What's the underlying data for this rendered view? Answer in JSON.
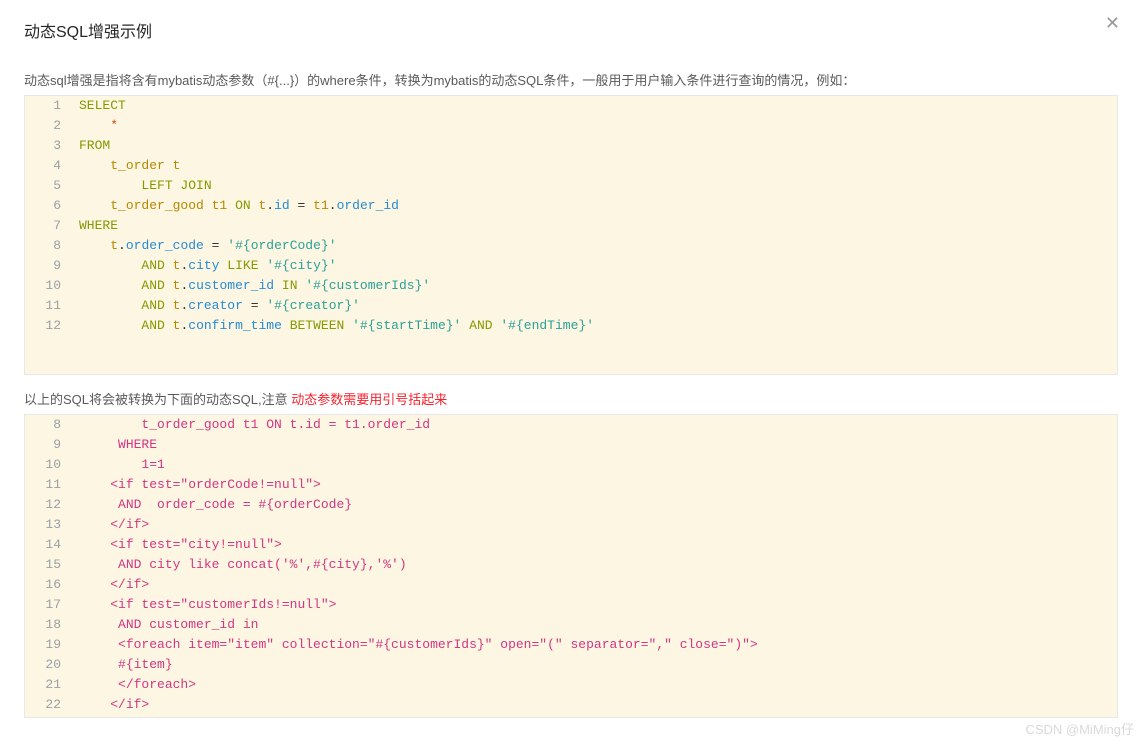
{
  "modal": {
    "title": "动态SQL增强示例",
    "close": "✕"
  },
  "section1": {
    "desc": "动态sql增强是指将含有mybatis动态参数（#{...}）的where条件，转换为mybatis的动态SQL条件，一般用于用户输入条件进行查询的情况，例如：",
    "lines": [
      {
        "n": "1",
        "html": "<span class='tok-kw'>SELECT</span>"
      },
      {
        "n": "2",
        "html": "    <span class='tok-star'>*</span>"
      },
      {
        "n": "3",
        "html": "<span class='tok-kw'>FROM</span>"
      },
      {
        "n": "4",
        "html": "    <span class='tok-id'>t_order t</span>"
      },
      {
        "n": "5",
        "html": "        <span class='tok-kw'>LEFT JOIN</span>"
      },
      {
        "n": "6",
        "html": "    <span class='tok-id'>t_order_good t1</span> <span class='tok-kw'>ON</span> <span class='tok-id'>t</span>.<span class='tok-col'>id</span> <span class='tok-op'>=</span> <span class='tok-id'>t1</span>.<span class='tok-col'>order_id</span>"
      },
      {
        "n": "7",
        "html": "<span class='tok-kw'>WHERE</span>"
      },
      {
        "n": "8",
        "html": "    <span class='tok-id'>t</span>.<span class='tok-col'>order_code</span> <span class='tok-op'>=</span> <span class='tok-str'>'#{orderCode}'</span>"
      },
      {
        "n": "9",
        "html": "        <span class='tok-kw'>AND</span> <span class='tok-id'>t</span>.<span class='tok-col'>city</span> <span class='tok-kw'>LIKE</span> <span class='tok-str'>'#{city}'</span>"
      },
      {
        "n": "10",
        "html": "        <span class='tok-kw'>AND</span> <span class='tok-id'>t</span>.<span class='tok-col'>customer_id</span> <span class='tok-kw'>IN</span> <span class='tok-str'>'#{customerIds}'</span>"
      },
      {
        "n": "11",
        "html": "        <span class='tok-kw'>AND</span> <span class='tok-id'>t</span>.<span class='tok-col'>creator</span> <span class='tok-op'>=</span> <span class='tok-str'>'#{creator}'</span>"
      },
      {
        "n": "12",
        "html": "        <span class='tok-kw'>AND</span> <span class='tok-id'>t</span>.<span class='tok-col'>confirm_time</span> <span class='tok-kw'>BETWEEN</span> <span class='tok-str'>'#{startTime}'</span> <span class='tok-kw'>AND</span> <span class='tok-str'>'#{endTime}'</span>"
      }
    ]
  },
  "section2": {
    "desc_pre": "以上的SQL将会被转换为下面的动态SQL,注意 ",
    "desc_warn": "动态参数需要用引号括起来",
    "lines": [
      {
        "n": "8",
        "html": "        <span class='tok-pink'>t_order_good t1 ON t.id = t1.order_id</span>"
      },
      {
        "n": "9",
        "html": "     <span class='tok-pink'>WHERE</span>"
      },
      {
        "n": "10",
        "html": "        <span class='tok-pink'>1=1</span>"
      },
      {
        "n": "11",
        "html": "    <span class='tok-pink'>&lt;if test=\"orderCode!=null\"&gt;</span>"
      },
      {
        "n": "12",
        "html": "     <span class='tok-pink'>AND  order_code = #{orderCode}</span>"
      },
      {
        "n": "13",
        "html": "    <span class='tok-pink'>&lt;/if&gt;</span>"
      },
      {
        "n": "14",
        "html": "    <span class='tok-pink'>&lt;if test=\"city!=null\"&gt;</span>"
      },
      {
        "n": "15",
        "html": "     <span class='tok-pink'>AND city like concat('%',#{city},'%')</span>"
      },
      {
        "n": "16",
        "html": "    <span class='tok-pink'>&lt;/if&gt;</span>"
      },
      {
        "n": "17",
        "html": "    <span class='tok-pink'>&lt;if test=\"customerIds!=null\"&gt;</span>"
      },
      {
        "n": "18",
        "html": "     <span class='tok-pink'>AND customer_id in</span>"
      },
      {
        "n": "19",
        "html": "     <span class='tok-pink'>&lt;foreach item=\"item\" collection=\"#{customerIds}\" open=\"(\" separator=\",\" close=\")\"&gt;</span>"
      },
      {
        "n": "20",
        "html": "     <span class='tok-pink'>#{item}</span>"
      },
      {
        "n": "21",
        "html": "     <span class='tok-pink'>&lt;/foreach&gt;</span>"
      },
      {
        "n": "22",
        "html": "    <span class='tok-pink'>&lt;/if&gt;</span>"
      }
    ]
  },
  "watermark": "CSDN @MiMing仔"
}
